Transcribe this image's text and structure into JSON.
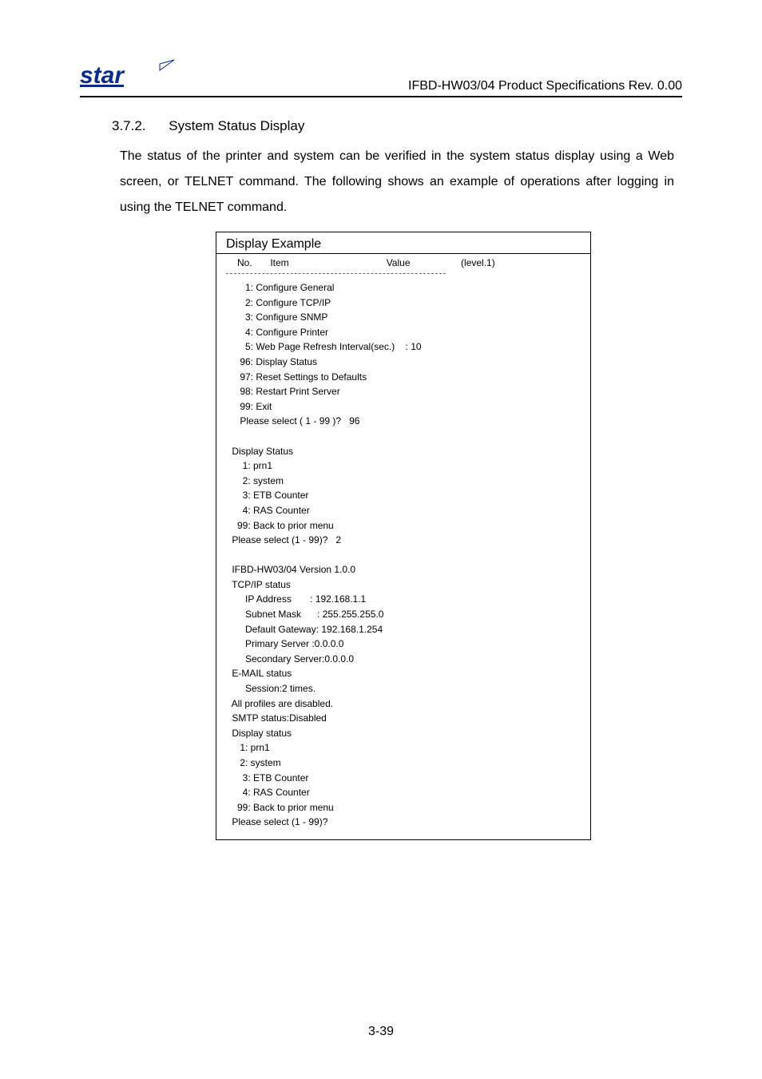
{
  "header": {
    "doc_title": "IFBD-HW03/04 Product Specifications Rev. 0.00",
    "logo_text": "star"
  },
  "section": {
    "number": "3.7.2.",
    "title": "System Status Display",
    "body": "The status of the printer and system can be verified in the system status display using a Web screen, or TELNET command.  The following shows an example of operations after logging in using the TELNET command."
  },
  "example": {
    "title": "Display Example",
    "cols": {
      "no": "No.",
      "item": "Item",
      "value": "Value",
      "level": "(level.1)"
    },
    "terminal": "      1: Configure General\n      2: Configure TCP/IP\n      3: Configure SNMP\n      4: Configure Printer\n      5: Web Page Refresh Interval(sec.)    : 10\n    96: Display Status\n    97: Reset Settings to Defaults\n    98: Restart Print Server\n    99: Exit\n    Please select ( 1 - 99 )?   96\n\n Display Status\n     1: prn1\n     2: system\n     3: ETB Counter\n     4: RAS Counter\n   99: Back to prior menu\n Please select (1 - 99)?   2\n\n IFBD-HW03/04 Version 1.0.0\n TCP/IP status\n      IP Address       : 192.168.1.1\n      Subnet Mask      : 255.255.255.0\n      Default Gateway: 192.168.1.254\n      Primary Server :0.0.0.0\n      Secondary Server:0.0.0.0\n E-MAIL status\n      Session:2 times.\n All profiles are disabled.\n SMTP status:Disabled\n Display status\n    1: prn1\n    2: system\n     3: ETB Counter\n     4: RAS Counter\n   99: Back to prior menu\n Please select (1 - 99)?"
  },
  "footer": {
    "page": "3-39"
  }
}
